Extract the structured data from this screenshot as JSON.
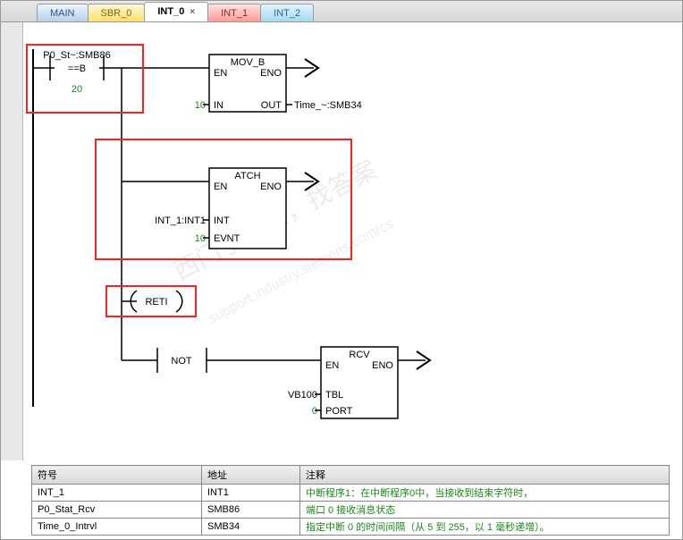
{
  "tabs": [
    {
      "label": "MAIN",
      "cls": "tab-main",
      "close": false
    },
    {
      "label": "SBR_0",
      "cls": "tab-sbr",
      "close": false
    },
    {
      "label": "INT_0",
      "cls": "tab-int0",
      "close": true
    },
    {
      "label": "INT_1",
      "cls": "tab-int1",
      "close": false
    },
    {
      "label": "INT_2",
      "cls": "tab-int2",
      "close": false
    }
  ],
  "ladder": {
    "contact": {
      "label": "P0_St~:SMB86",
      "op": "==B",
      "value": "20"
    },
    "mov_b": {
      "title": "MOV_B",
      "en": "EN",
      "eno": "ENO",
      "in_val": "10",
      "in": "IN",
      "out": "OUT",
      "out_label": "Time_~:SMB34"
    },
    "atch": {
      "title": "ATCH",
      "en": "EN",
      "eno": "ENO",
      "int_label": "INT_1:INT1",
      "int": "INT",
      "evnt_val": "10",
      "evnt": "EVNT"
    },
    "reti": {
      "label": "RETI"
    },
    "not": {
      "label": "NOT"
    },
    "rcv": {
      "title": "RCV",
      "en": "EN",
      "eno": "ENO",
      "tbl_label": "VB100",
      "tbl": "TBL",
      "port_val": "0",
      "port": "PORT"
    }
  },
  "table": {
    "headers": {
      "sym": "符号",
      "addr": "地址",
      "comment": "注释"
    },
    "rows": [
      {
        "sym": "INT_1",
        "addr": "INT1",
        "comment": "中断程序1：在中断程序0中，当接收到结束字符时，"
      },
      {
        "sym": "P0_Stat_Rcv",
        "addr": "SMB86",
        "comment": "端口 0 接收消息状态"
      },
      {
        "sym": "Time_0_Intrvl",
        "addr": "SMB34",
        "comment": "指定中断 0 的时间间隔（从 5 到 255，以 1 毫秒递增）。"
      }
    ]
  },
  "watermark": {
    "line1": "西门子工业，找答案",
    "line2": "support.industry.siemens.com/cs"
  }
}
